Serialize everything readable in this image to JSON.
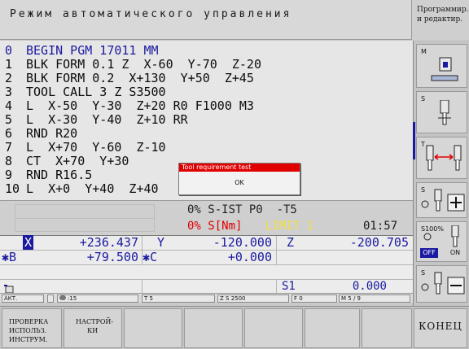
{
  "header": {
    "title": "Режим автоматического управления",
    "mode_lines": [
      "Программир.",
      "и редактир."
    ]
  },
  "program": {
    "lines": [
      {
        "n": "0",
        "text": "BEGIN PGM 17011 MM"
      },
      {
        "n": "1",
        "text": "BLK FORM 0.1 Z  X-60  Y-70  Z-20"
      },
      {
        "n": "2",
        "text": "BLK FORM 0.2  X+130  Y+50  Z+45"
      },
      {
        "n": "3",
        "text": "TOOL CALL 3 Z S3500"
      },
      {
        "n": "4",
        "text": "L  X-50  Y-30  Z+20 R0 F1000 M3"
      },
      {
        "n": "5",
        "text": "L  X-30  Y-40  Z+10 RR"
      },
      {
        "n": "6",
        "text": "RND R20"
      },
      {
        "n": "7",
        "text": "L  X+70  Y-60  Z-10"
      },
      {
        "n": "8",
        "text": "CT  X+70  Y+30"
      },
      {
        "n": "9",
        "text": "RND R16.5"
      },
      {
        "n": "10",
        "text": "L  X+0  Y+40  Z+40"
      }
    ]
  },
  "dialog": {
    "title": "Tool requirement test",
    "button": "OK"
  },
  "status": {
    "line1": "0% S-IST P0  -T5",
    "line2_pct": "0% S[Nm]",
    "line2_limit": "LIMIT 1",
    "line2_time": "01:57"
  },
  "positions": {
    "row1": [
      {
        "axis": "X",
        "value": "+236.437"
      },
      {
        "axis": "Y",
        "value": "-120.000"
      },
      {
        "axis": "Z",
        "value": "-200.705"
      }
    ],
    "row2": [
      {
        "axis": "B",
        "value": "+79.500"
      },
      {
        "axis": "C",
        "value": "+0.000"
      }
    ],
    "s1_label": "S1",
    "s1_value": "0.000"
  },
  "bottom_status": {
    "mode": "АКТ.",
    "tool": ":15",
    "t": "T 5",
    "z": "Z S 2500",
    "f": "F 0",
    "m": "M 5 / 9"
  },
  "softkeys": [
    {
      "label_lines": [
        "ПРОВЕРКА",
        "ИСПОЛЬЗ.",
        "ИНСТРУМ."
      ]
    },
    {
      "label_lines": [
        "НАСТРОЙ-",
        "КИ"
      ]
    },
    {
      "label_lines": []
    },
    {
      "label_lines": []
    },
    {
      "label_lines": []
    },
    {
      "label_lines": []
    },
    {
      "label_lines": [
        "КОНЕЦ"
      ]
    }
  ],
  "right_panel": {
    "m_label": "M",
    "s_label": "S",
    "t_label": "T",
    "s100_label": "S100%",
    "off_label": "OFF",
    "on_label": "ON"
  },
  "colors": {
    "accent_blue": "#1a1aa0",
    "limit_yellow": "#f0e040",
    "alert_red": "#e00000",
    "dialog_red": "#e00000"
  }
}
